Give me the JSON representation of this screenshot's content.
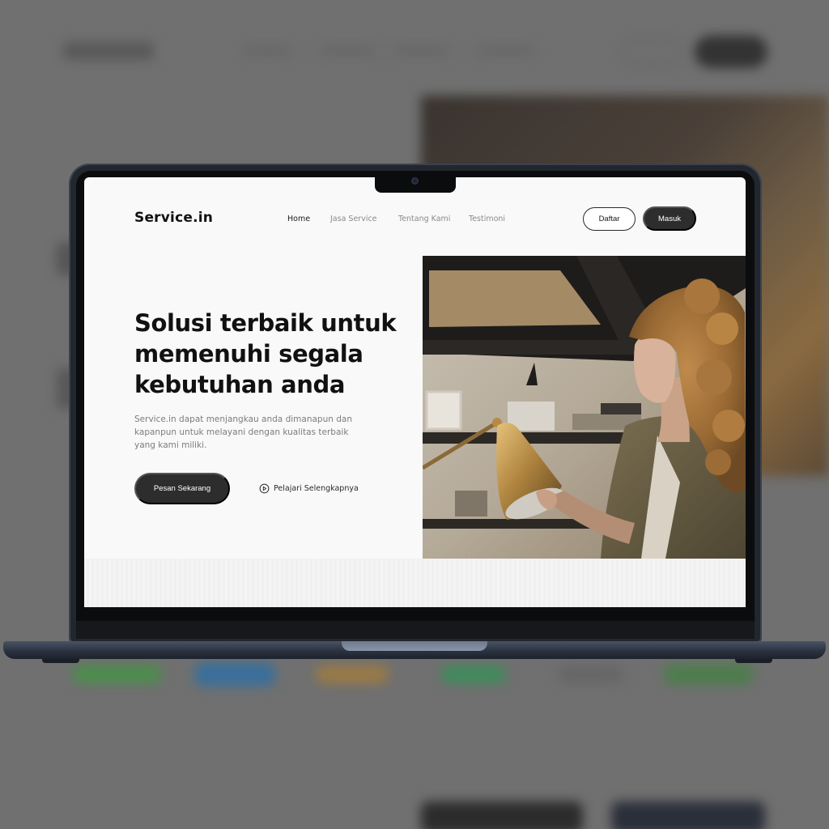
{
  "app": {
    "brand": "Service.in"
  },
  "nav": {
    "items": [
      {
        "label": "Home",
        "active": true
      },
      {
        "label": "Jasa Service",
        "active": false
      },
      {
        "label": "Tentang Kami",
        "active": false
      },
      {
        "label": "Testimoni",
        "active": false
      }
    ]
  },
  "auth": {
    "register_label": "Daftar",
    "login_label": "Masuk"
  },
  "hero": {
    "headline_lines": [
      "Solusi terbaik untuk",
      "memenuhi segala",
      "kebutuhan anda"
    ],
    "description_lines": [
      "Service.in dapat menjangkau anda dimanapun dan",
      "kapanpun untuk melayani dengan kualitas terbaik",
      "yang kami miliki."
    ],
    "primary_cta": "Pesan Sekarang",
    "secondary_cta": "Pelajari Selengkapnya",
    "secondary_cta_icon": "play-circle-icon"
  },
  "colors": {
    "primary_dark": "#2d2d2d",
    "background": "#f9f9f9",
    "muted_text": "#7c7c7c",
    "laptop_frame": "#22262d"
  }
}
